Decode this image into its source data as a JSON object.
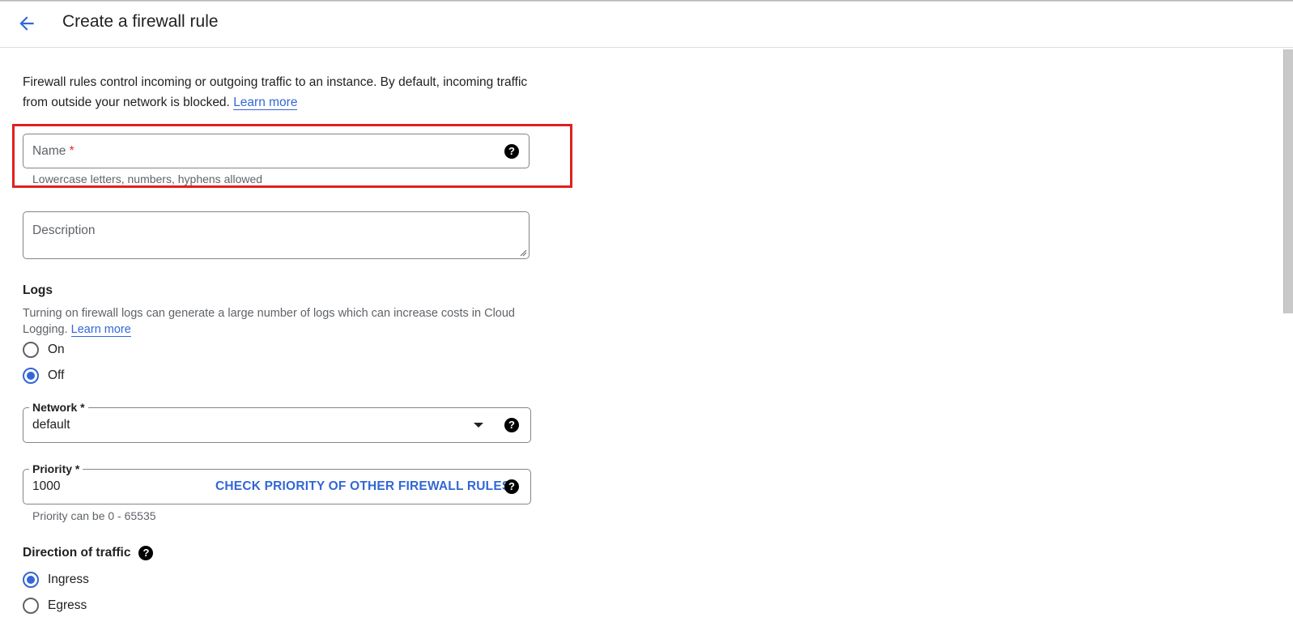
{
  "header": {
    "back_icon": "arrow-back-icon",
    "title": "Create a firewall rule"
  },
  "intro": {
    "text": "Firewall rules control incoming or outgoing traffic to an instance. By default, incoming traffic from outside your network is blocked.",
    "learn_more": "Learn more"
  },
  "name_field": {
    "label": "Name",
    "required_mark": "*",
    "value": "",
    "hint": "Lowercase letters, numbers, hyphens allowed",
    "help_icon": "help-icon"
  },
  "description_field": {
    "placeholder": "Description",
    "value": ""
  },
  "logs": {
    "title": "Logs",
    "description": "Turning on firewall logs can generate a large number of logs which can increase costs in Cloud Logging.",
    "learn_more": "Learn more",
    "options": [
      {
        "label": "On",
        "checked": false
      },
      {
        "label": "Off",
        "checked": true
      }
    ]
  },
  "network": {
    "label": "Network *",
    "value": "default",
    "help_icon": "help-icon"
  },
  "priority": {
    "label": "Priority *",
    "value": "1000",
    "check_button": "CHECK PRIORITY OF OTHER FIREWALL RULES",
    "hint": "Priority can be 0 - 65535",
    "help_icon": "help-icon"
  },
  "direction": {
    "title": "Direction of traffic",
    "help_icon": "help-icon",
    "options": [
      {
        "label": "Ingress",
        "checked": true
      },
      {
        "label": "Egress",
        "checked": false
      }
    ]
  },
  "colors": {
    "accent": "#3367d6",
    "annotation_box": "#e02020",
    "required": "#d93025"
  }
}
